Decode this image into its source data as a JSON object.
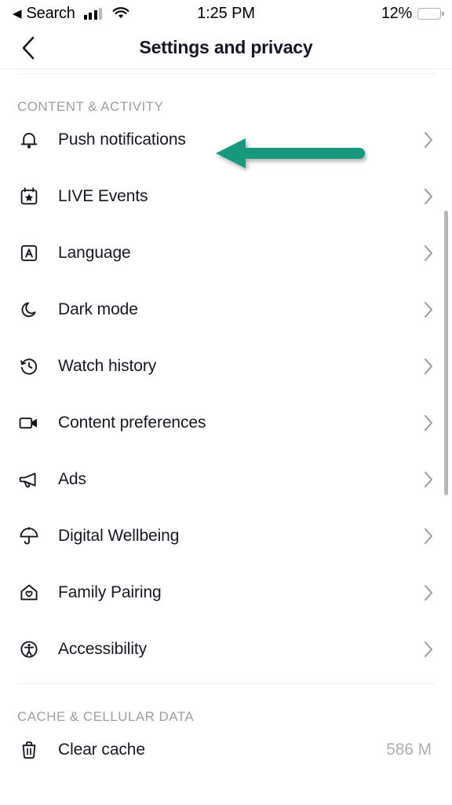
{
  "status_bar": {
    "back_caret": "◀",
    "carrier_label": "Search",
    "signal_icon": "cellular-signal-icon",
    "wifi_icon": "wifi-icon",
    "time": "1:25 PM",
    "battery_percent": "12%",
    "battery_icon": "battery-low-icon",
    "battery_level": 12
  },
  "nav": {
    "back_icon": "chevron-left-icon",
    "title": "Settings and privacy"
  },
  "sections": [
    {
      "header": "CONTENT & ACTIVITY",
      "items": [
        {
          "label": "Push notifications",
          "icon": "bell-icon",
          "value": "",
          "chevron": "›"
        },
        {
          "label": "LIVE Events",
          "icon": "calendar-star-icon",
          "value": "",
          "chevron": "›"
        },
        {
          "label": "Language",
          "icon": "language-a-icon",
          "value": "",
          "chevron": "›"
        },
        {
          "label": "Dark mode",
          "icon": "moon-icon",
          "value": "",
          "chevron": "›"
        },
        {
          "label": "Watch history",
          "icon": "clock-rewind-icon",
          "value": "",
          "chevron": "›"
        },
        {
          "label": "Content preferences",
          "icon": "video-camera-icon",
          "value": "",
          "chevron": "›"
        },
        {
          "label": "Ads",
          "icon": "megaphone-icon",
          "value": "",
          "chevron": "›"
        },
        {
          "label": "Digital Wellbeing",
          "icon": "umbrella-icon",
          "value": "",
          "chevron": "›"
        },
        {
          "label": "Family Pairing",
          "icon": "house-heart-icon",
          "value": "",
          "chevron": "›"
        },
        {
          "label": "Accessibility",
          "icon": "accessibility-icon",
          "value": "",
          "chevron": "›"
        }
      ]
    },
    {
      "header": "CACHE & CELLULAR DATA",
      "items": [
        {
          "label": "Clear cache",
          "icon": "trash-icon",
          "value": "586 M",
          "chevron": ""
        }
      ]
    }
  ],
  "annotation": {
    "type": "arrow-left",
    "target": "Push notifications",
    "color": "#16997c"
  },
  "colors": {
    "accent_green": "#16997c",
    "text_primary": "#161722",
    "text_muted": "#9e9e9e",
    "battery_red": "#f03e3e",
    "divider": "#ededed",
    "scrollbar": "#b5b5b5"
  }
}
